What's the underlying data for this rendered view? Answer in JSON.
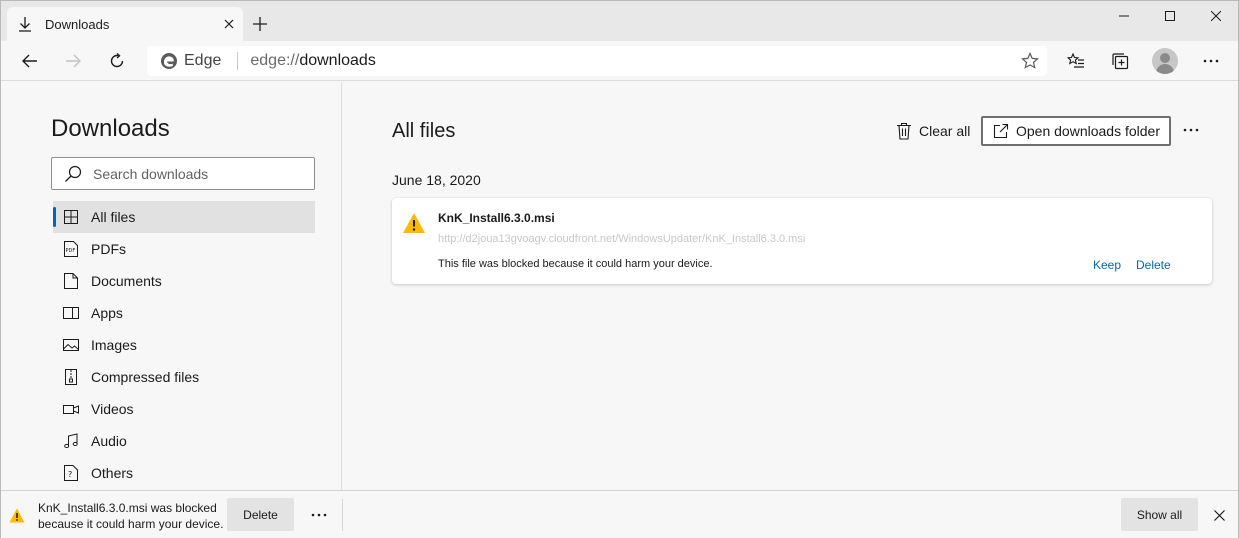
{
  "tab": {
    "title": "Downloads",
    "icon": "download-icon"
  },
  "window_controls": {
    "minimize_icon": "minimize-icon",
    "maximize_icon": "maximize-icon",
    "close_icon": "close-icon"
  },
  "toolbar": {
    "back_icon": "back-arrow-icon",
    "forward_icon": "forward-arrow-icon",
    "refresh_icon": "refresh-icon",
    "edge_label": "Edge",
    "url_scheme": "edge://",
    "url_path": "downloads",
    "favorite_icon": "star-icon",
    "favorites_icon": "favorites-list-icon",
    "collections_icon": "collections-icon",
    "more_icon": "ellipsis-icon"
  },
  "sidebar": {
    "title": "Downloads",
    "search_placeholder": "Search downloads",
    "items": [
      {
        "label": "All files",
        "icon": "grid-icon",
        "active": true
      },
      {
        "label": "PDFs",
        "icon": "pdf-icon",
        "active": false
      },
      {
        "label": "Documents",
        "icon": "document-icon",
        "active": false
      },
      {
        "label": "Apps",
        "icon": "app-icon",
        "active": false
      },
      {
        "label": "Images",
        "icon": "image-icon",
        "active": false
      },
      {
        "label": "Compressed files",
        "icon": "zip-icon",
        "active": false
      },
      {
        "label": "Videos",
        "icon": "video-icon",
        "active": false
      },
      {
        "label": "Audio",
        "icon": "music-icon",
        "active": false
      },
      {
        "label": "Others",
        "icon": "unknown-file-icon",
        "active": false
      }
    ]
  },
  "main": {
    "title": "All files",
    "clear_all": "Clear all",
    "open_folder": "Open downloads folder",
    "date_group": "June 18, 2020",
    "download": {
      "filename": "KnK_Install6.3.0.msi",
      "url": "http://d2joua13gvoagv.cloudfront.net/WindowsUpdater/KnK_Install6.3.0.msi",
      "message": "This file was blocked because it could harm your device.",
      "keep": "Keep",
      "delete": "Delete"
    }
  },
  "shelf": {
    "message_line1": "KnK_Install6.3.0.msi was blocked",
    "message_line2": "because it could harm your device.",
    "delete": "Delete",
    "show_all": "Show all"
  },
  "colors": {
    "accent": "#0067b8",
    "warning": "#ffb900",
    "background": "#f7f7f7"
  }
}
